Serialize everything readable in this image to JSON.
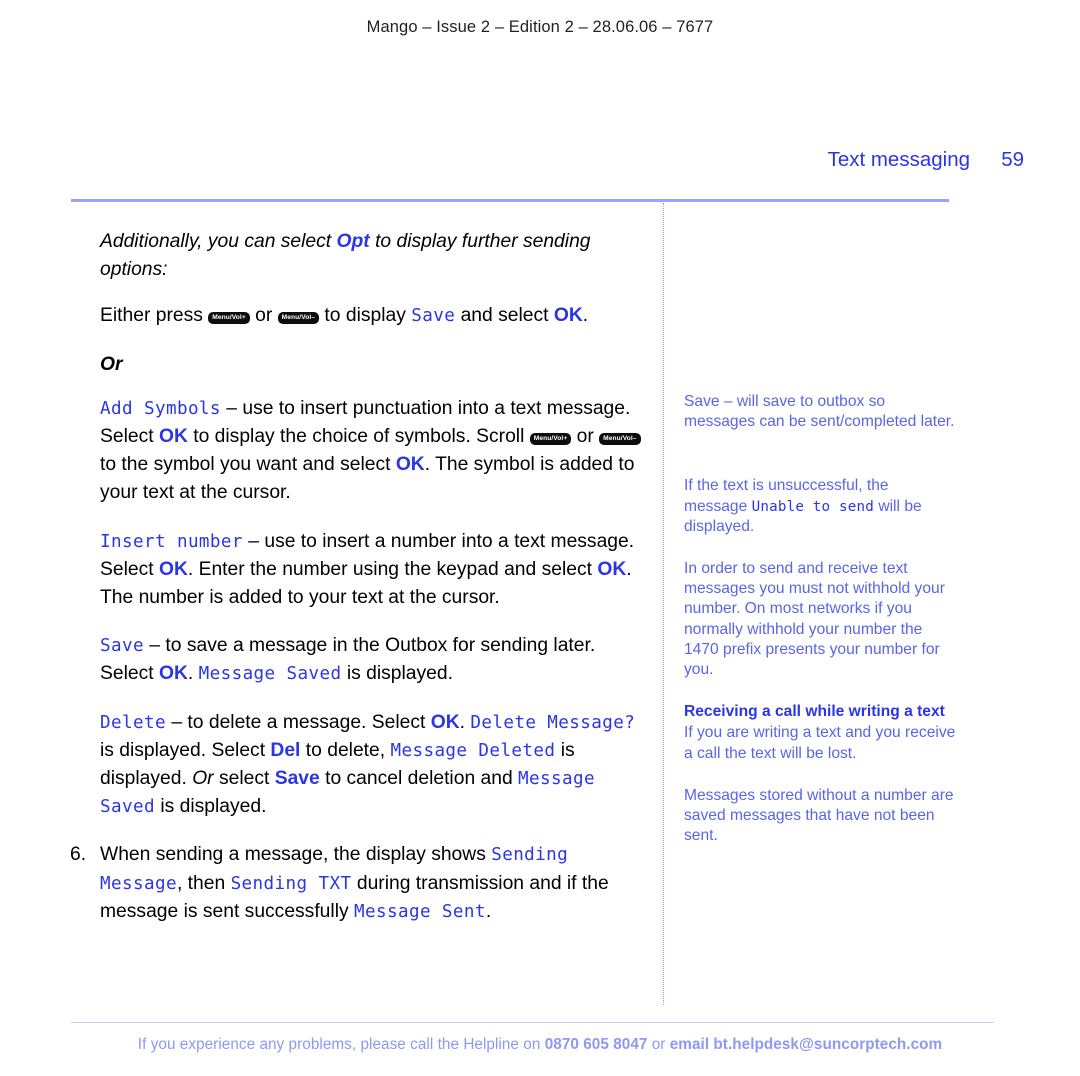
{
  "running_head": "Mango – Issue 2 – Edition 2 – 28.06.06 – 7677",
  "header": {
    "title": "Text messaging",
    "page_number": "59",
    "accent_color": "#2b35e8",
    "rule_color": "#9aa3f7"
  },
  "keys": {
    "vol_up": "Menu/Vol+",
    "vol_down": "Menu/Vol–"
  },
  "softkeys": {
    "ok": "OK",
    "opt": "Opt",
    "del": "Del",
    "save": "Save"
  },
  "main": {
    "intro": {
      "part1": "Additionally, you can select ",
      "opt": "Opt",
      "part2": " to display further sending options:"
    },
    "either_press": {
      "part1": "Either press ",
      "part2": " or ",
      "part3": " to display ",
      "lcd_save": "Save",
      "part4": " and select ",
      "ok": "OK",
      "part5": "."
    },
    "or_label": "Or",
    "add_symbols": {
      "lcd_title": "Add Symbols",
      "part1": " – use to insert punctuation into a text message. Select ",
      "ok1": "OK",
      "part2": " to display the choice of symbols. Scroll ",
      "part3": " or ",
      "part4": " to the symbol you want and select ",
      "ok2": "OK",
      "part5": ". The symbol is added to your text at the cursor."
    },
    "insert_number": {
      "lcd_title": "Insert number",
      "part1": " – use to insert a number into a text message. Select ",
      "ok1": "OK",
      "part2": ". Enter the number using the keypad and select ",
      "ok2": "OK",
      "part3": ". The number is added to your text at the cursor."
    },
    "save_option": {
      "lcd_title": "Save",
      "part1": " – to save a message in the Outbox for sending later. Select ",
      "ok": "OK",
      "part2": ". ",
      "lcd_message_saved": "Message Saved",
      "part3": " is displayed."
    },
    "delete_option": {
      "lcd_title": "Delete",
      "part1": " – to delete a message. Select ",
      "ok": "OK",
      "part2": ". ",
      "lcd_delete_message": "Delete Message?",
      "part3": " is displayed. Select ",
      "del": "Del",
      "part4": " to delete, ",
      "lcd_message_deleted": "Message Deleted",
      "part5": " is displayed. ",
      "or": "Or",
      "part6": " select ",
      "save": "Save",
      "part7": " to cancel deletion and ",
      "lcd_message_saved": "Message Saved",
      "part8": " is displayed."
    },
    "step6": {
      "number": "6.",
      "part1": "When sending a message, the display shows ",
      "lcd_sending_message": "Sending Message",
      "part2": ", then ",
      "lcd_sending_txt": "Sending TXT",
      "part3": " during transmission and if the message is sent successfully ",
      "lcd_message_sent": "Message Sent",
      "part4": "."
    }
  },
  "sidebar": {
    "note_save": "Save – will save to outbox so messages can be sent/completed later.",
    "note_unsuccessful": {
      "part1": "If the text is unsuccessful, the message ",
      "lcd": "Unable to send",
      "part2": " will be displayed."
    },
    "note_withhold": "In order to send and receive text messages you must not withhold your number. On most networks if you normally withhold your number the 1470 prefix presents your number for you.",
    "heading_receiving_call": "Receiving a call while writing a text",
    "note_receiving_call": "If you are writing a text and you receive a call the text will be lost.",
    "note_stored_without_number": "Messages stored without a number are saved messages that have not been sent.",
    "text_color": "#5965e8",
    "heading_color": "#2b35e8"
  },
  "footer": {
    "part1": "If you experience any problems, please call the Helpline on ",
    "phone": "0870 605 8047",
    "part2": " or ",
    "email": "email bt.helpdesk@suncorptech.com",
    "color": "#8f98f2"
  }
}
